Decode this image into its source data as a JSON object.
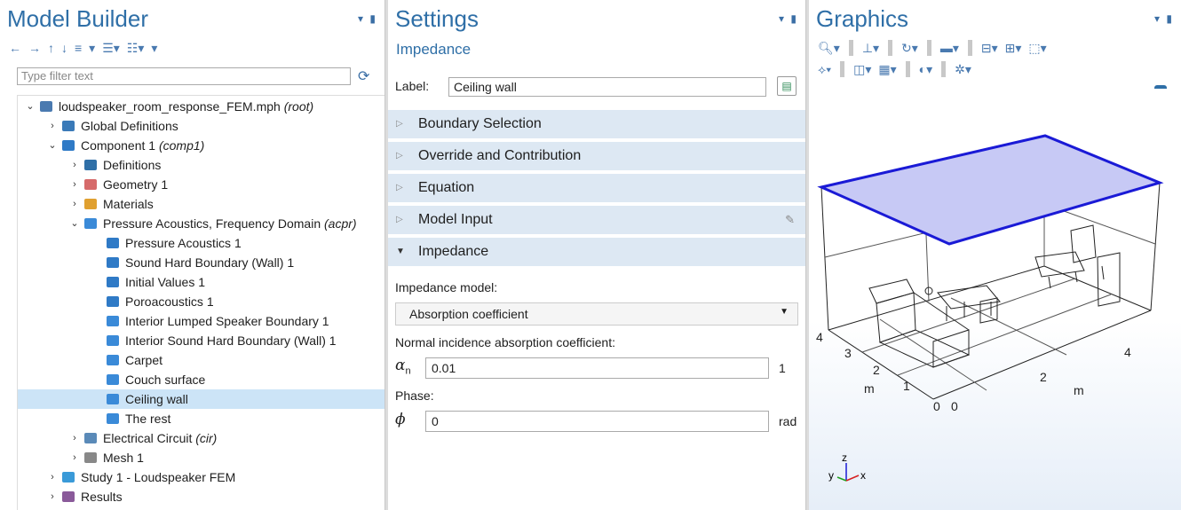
{
  "model_builder": {
    "title": "Model Builder",
    "pin": "▾ ▮",
    "toolbar": [
      "←",
      "→",
      "↑",
      "↓",
      "≡",
      "▾",
      "☰▾",
      "☷▾",
      "▾"
    ],
    "filter_placeholder": "Type filter text",
    "tree": [
      {
        "label": "loudspeaker_room_response_FEM.mph",
        "em": "(root)",
        "twisty": "⌄",
        "icon_color": "#4a7ab0",
        "indent": 0
      },
      {
        "label": "Global Definitions",
        "em": "",
        "twisty": "›",
        "icon_color": "#3a7ab8",
        "indent": 1
      },
      {
        "label": "Component 1",
        "em": "(comp1)",
        "twisty": "⌄",
        "icon_color": "#2f7ac6",
        "indent": 1
      },
      {
        "label": "Definitions",
        "em": "",
        "twisty": "›",
        "icon_color": "#2f6fa7",
        "indent": 2
      },
      {
        "label": "Geometry 1",
        "em": "",
        "twisty": "›",
        "icon_color": "#d66a6a",
        "indent": 2
      },
      {
        "label": "Materials",
        "em": "",
        "twisty": "›",
        "icon_color": "#e0a030",
        "indent": 2
      },
      {
        "label": "Pressure Acoustics, Frequency Domain",
        "em": "(acpr)",
        "twisty": "⌄",
        "icon_color": "#3a8ad8",
        "indent": 2
      },
      {
        "label": "Pressure Acoustics 1",
        "em": "",
        "twisty": "",
        "icon_color": "#2f7ac6",
        "indent": 3
      },
      {
        "label": "Sound Hard Boundary (Wall) 1",
        "em": "",
        "twisty": "",
        "icon_color": "#2f7ac6",
        "indent": 3
      },
      {
        "label": "Initial Values 1",
        "em": "",
        "twisty": "",
        "icon_color": "#2f7ac6",
        "indent": 3
      },
      {
        "label": "Poroacoustics 1",
        "em": "",
        "twisty": "",
        "icon_color": "#2f7ac6",
        "indent": 3
      },
      {
        "label": "Interior Lumped Speaker Boundary 1",
        "em": "",
        "twisty": "",
        "icon_color": "#3a8ad8",
        "indent": 3
      },
      {
        "label": "Interior Sound Hard Boundary (Wall) 1",
        "em": "",
        "twisty": "",
        "icon_color": "#3a8ad8",
        "indent": 3
      },
      {
        "label": "Carpet",
        "em": "",
        "twisty": "",
        "icon_color": "#3a8ad8",
        "indent": 3
      },
      {
        "label": "Couch surface",
        "em": "",
        "twisty": "",
        "icon_color": "#3a8ad8",
        "indent": 3
      },
      {
        "label": "Ceiling wall",
        "em": "",
        "twisty": "",
        "icon_color": "#3a8ad8",
        "indent": 3,
        "selected": true
      },
      {
        "label": "The rest",
        "em": "",
        "twisty": "",
        "icon_color": "#3a8ad8",
        "indent": 3
      },
      {
        "label": "Electrical Circuit",
        "em": "(cir)",
        "twisty": "›",
        "icon_color": "#5a8ab8",
        "indent": 2
      },
      {
        "label": "Mesh 1",
        "em": "",
        "twisty": "›",
        "icon_color": "#888888",
        "indent": 2
      },
      {
        "label": "Study 1 - Loudspeaker FEM",
        "em": "",
        "twisty": "›",
        "icon_color": "#3a9ad8",
        "indent": 1
      },
      {
        "label": "Results",
        "em": "",
        "twisty": "›",
        "icon_color": "#8a5a9a",
        "indent": 1
      }
    ]
  },
  "settings": {
    "title": "Settings",
    "subtitle": "Impedance",
    "label_caption": "Label:",
    "label_value": "Ceiling wall",
    "sections": [
      {
        "label": "Boundary Selection",
        "expanded": false
      },
      {
        "label": "Override and Contribution",
        "expanded": false
      },
      {
        "label": "Equation",
        "expanded": false
      },
      {
        "label": "Model Input",
        "expanded": false
      },
      {
        "label": "Impedance",
        "expanded": true
      }
    ],
    "impedance_model_label": "Impedance model:",
    "impedance_model_value": "Absorption coefficient",
    "absorption_label": "Normal incidence absorption coefficient:",
    "alpha_symbol": "αn",
    "alpha_value": "0.01",
    "alpha_unit": "1",
    "phase_label": "Phase:",
    "phi_symbol": "ϕ",
    "phi_value": "0",
    "phi_unit": "rad"
  },
  "graphics": {
    "title": "Graphics",
    "axis_labels": {
      "x_ticks": [
        "0",
        "2",
        "4"
      ],
      "y_ticks": [
        "0",
        "1",
        "2",
        "3",
        "4"
      ],
      "x_unit": "m",
      "y_unit": "m"
    },
    "triad": {
      "x": "x",
      "y": "y",
      "z": "z"
    },
    "highlight_color": "#1a1ad6"
  }
}
